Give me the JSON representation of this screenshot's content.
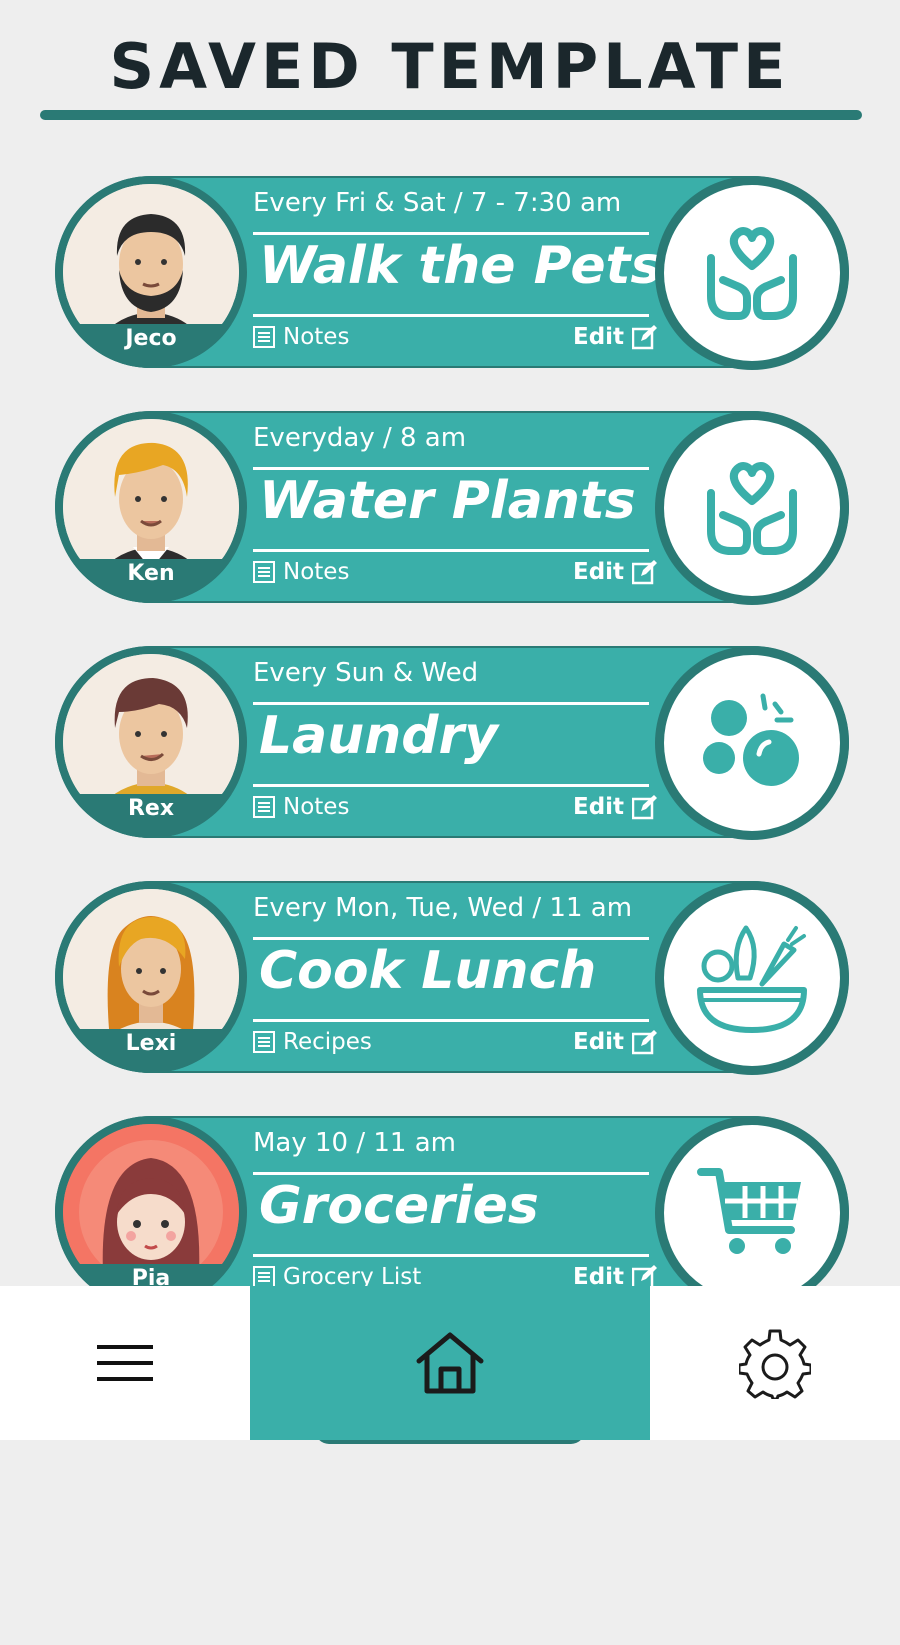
{
  "page": {
    "title": "SAVED TEMPLATE"
  },
  "colors": {
    "accent": "#3aafa9",
    "accent_dark": "#2a7a75",
    "background": "#eeeeee",
    "title": "#1b272c"
  },
  "cards": [
    {
      "person": "Jeco",
      "schedule": "Every Fri & Sat  /  7 - 7:30 am",
      "task": "Walk the Pets",
      "link_label": "Notes",
      "edit_label": "Edit",
      "icon": "caring-hands-heart-icon"
    },
    {
      "person": "Ken",
      "schedule": "Everyday  /  8 am",
      "task": "Water Plants",
      "link_label": "Notes",
      "edit_label": "Edit",
      "icon": "caring-hands-heart-icon"
    },
    {
      "person": "Rex",
      "schedule": "Every Sun & Wed",
      "task": "Laundry",
      "link_label": "Notes",
      "edit_label": "Edit",
      "icon": "bubbles-icon"
    },
    {
      "person": "Lexi",
      "schedule": "Every Mon, Tue, Wed  /  11 am",
      "task": "Cook Lunch",
      "link_label": "Recipes",
      "edit_label": "Edit",
      "icon": "salad-bowl-icon"
    },
    {
      "person": "Pia",
      "schedule": "May 10  /  11 am",
      "task": "Groceries",
      "link_label": "Grocery List",
      "edit_label": "Edit",
      "icon": "shopping-cart-icon"
    }
  ],
  "bottom_nav": {
    "left": "menu-icon",
    "center": "home-icon",
    "right": "settings-gear-icon"
  }
}
